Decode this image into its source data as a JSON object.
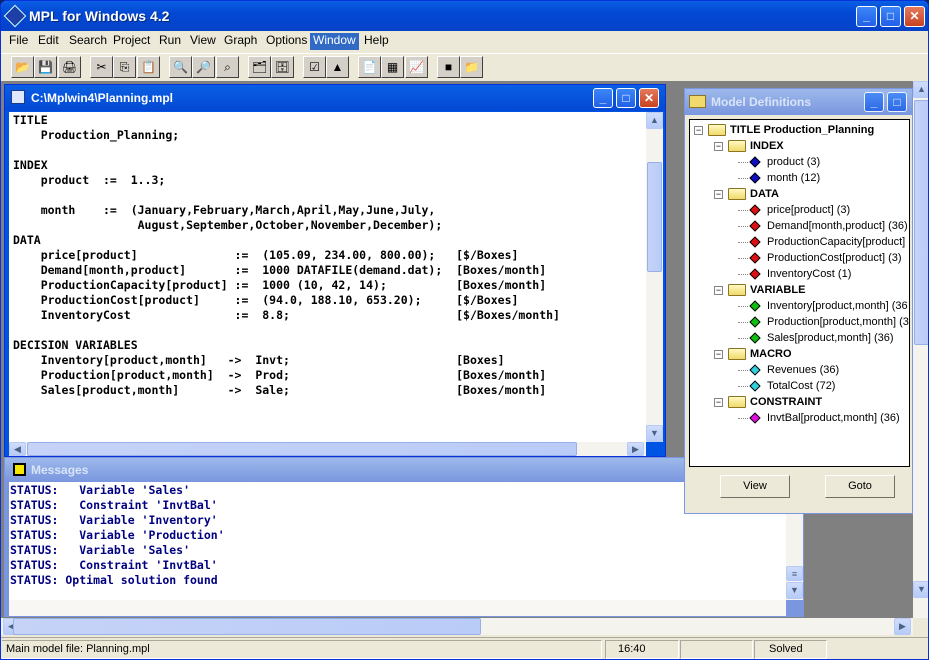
{
  "app": {
    "title": "MPL for Windows 4.2",
    "window_controls": {
      "minimize": "_",
      "maximize": "□",
      "close": "✕"
    }
  },
  "menu": [
    "File",
    "Edit",
    "Search",
    "Project",
    "Run",
    "View",
    "Graph",
    "Options",
    "Window",
    "Help"
  ],
  "menu_active": "Window",
  "toolbar": [
    {
      "name": "open-icon",
      "glyph": "📂"
    },
    {
      "name": "save-icon",
      "glyph": "💾"
    },
    {
      "name": "print-icon",
      "glyph": "🖨"
    },
    {
      "name": "cut-icon",
      "glyph": "✂"
    },
    {
      "name": "copy-icon",
      "glyph": "⎘"
    },
    {
      "name": "paste-icon",
      "glyph": "📋"
    },
    {
      "name": "find-icon",
      "glyph": "🔍"
    },
    {
      "name": "replace-icon",
      "glyph": "🔎"
    },
    {
      "name": "find-next-icon",
      "glyph": "⌕"
    },
    {
      "name": "open-project-icon",
      "glyph": "🗂"
    },
    {
      "name": "save-project-icon",
      "glyph": "🗄"
    },
    {
      "name": "check-syntax-icon",
      "glyph": "☑"
    },
    {
      "name": "solve-icon",
      "glyph": "▲"
    },
    {
      "name": "view-solution-icon",
      "glyph": "📄"
    },
    {
      "name": "graph-matrix-icon",
      "glyph": "▦"
    },
    {
      "name": "graph-chart-icon",
      "glyph": "📈"
    },
    {
      "name": "messages-window-icon",
      "glyph": "■"
    },
    {
      "name": "model-definitions-icon",
      "glyph": "📁"
    }
  ],
  "editor": {
    "title": "C:\\Mplwin4\\Planning.mpl",
    "lines": [
      "TITLE",
      "    Production_Planning;",
      "",
      "INDEX",
      "    product  :=  1..3;",
      "",
      "    month    :=  (January,February,March,April,May,June,July,",
      "                  August,September,October,November,December);",
      "DATA",
      "    price[product]              :=  (105.09, 234.00, 800.00);   [$/Boxes]",
      "    Demand[month,product]       :=  1000 DATAFILE(demand.dat);  [Boxes/month]",
      "    ProductionCapacity[product] :=  1000 (10, 42, 14);          [Boxes/month]",
      "    ProductionCost[product]     :=  (94.0, 188.10, 653.20);     [$/Boxes]",
      "    InventoryCost               :=  8.8;                        [$/Boxes/month]",
      "",
      "DECISION VARIABLES",
      "    Inventory[product,month]   ->  Invt;                        [Boxes]",
      "    Production[product,month]  ->  Prod;                        [Boxes/month]",
      "    Sales[product,month]       ->  Sale;                        [Boxes/month]"
    ]
  },
  "messages": {
    "title": "Messages",
    "lines": [
      "STATUS:   Variable 'Sales'",
      "STATUS:   Constraint 'InvtBal'",
      "STATUS:   Variable 'Inventory'",
      "STATUS:   Variable 'Production'",
      "STATUS:   Variable 'Sales'",
      "STATUS:   Constraint 'InvtBal'",
      "STATUS: Optimal solution found"
    ]
  },
  "model_definitions": {
    "title": "Model Definitions",
    "root": "TITLE Production_Planning",
    "groups": [
      {
        "label": "INDEX",
        "color": "#1010c0",
        "items": [
          "product  (3)",
          "month  (12)"
        ]
      },
      {
        "label": "DATA",
        "color": "#e01010",
        "items": [
          "price[product]  (3)",
          "Demand[month,product]  (36)",
          "ProductionCapacity[product]",
          "ProductionCost[product]  (3)",
          "InventoryCost  (1)"
        ]
      },
      {
        "label": "VARIABLE",
        "color": "#10c010",
        "items": [
          "Inventory[product,month]  (36",
          "Production[product,month]  (3",
          "Sales[product,month]  (36)"
        ]
      },
      {
        "label": "MACRO",
        "color": "#30d0e0",
        "items": [
          "Revenues  (36)",
          "TotalCost  (72)"
        ]
      },
      {
        "label": "CONSTRAINT",
        "color": "#e010e0",
        "items": [
          "InvtBal[product,month]  (36)"
        ]
      }
    ],
    "buttons": {
      "view": "View",
      "goto": "Goto"
    }
  },
  "status": {
    "file": "Main model file: Planning.mpl",
    "time": "16:40",
    "empty": "",
    "state": "Solved"
  }
}
